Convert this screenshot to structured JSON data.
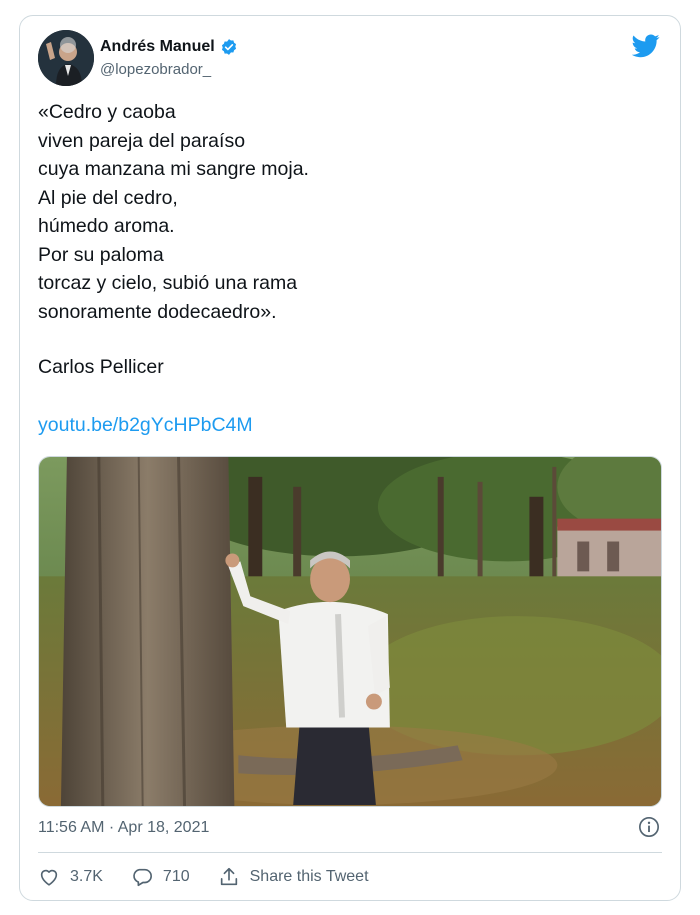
{
  "author": {
    "display_name": "Andrés Manuel",
    "handle": "@lopezobrador_"
  },
  "tweet": {
    "lines": [
      "«Cedro y caoba",
      "viven pareja del paraíso",
      "cuya manzana mi sangre moja.",
      "Al pie del cedro,",
      "húmedo aroma.",
      "Por su paloma",
      "torcaz y cielo, subió una rama",
      "sonoramente dodecaedro»."
    ],
    "attribution": "Carlos Pellicer",
    "link": "youtu.be/b2gYcHPbC4M",
    "timestamp": "11:56 AM · Apr 18, 2021"
  },
  "actions": {
    "likes": "3.7K",
    "replies": "710",
    "share_label": "Share this Tweet"
  },
  "icons": {
    "brand": "twitter-bird-icon",
    "verified": "verified-badge-icon",
    "info": "info-icon",
    "like": "heart-icon",
    "reply": "reply-icon",
    "share": "share-icon"
  },
  "colors": {
    "accent": "#1d9bf0",
    "text": "#0f1419",
    "muted": "#536471",
    "border": "#cfd9de"
  }
}
